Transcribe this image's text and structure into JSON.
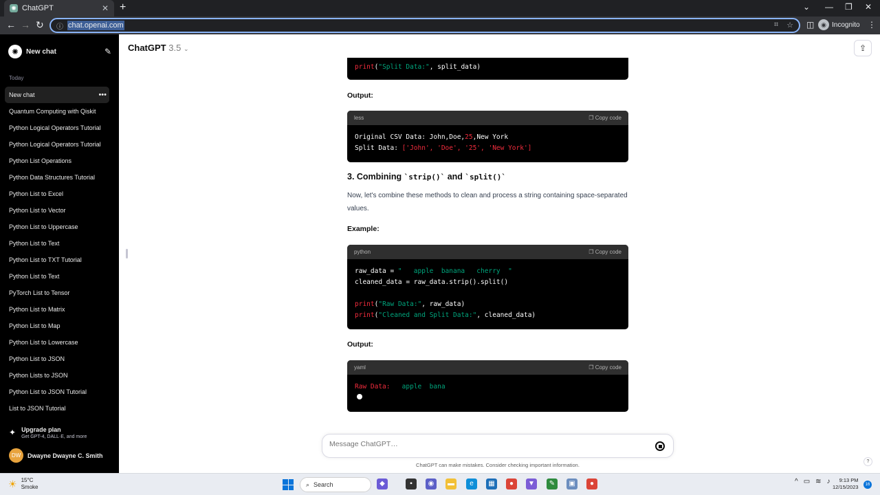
{
  "browser": {
    "tab_title": "ChatGPT",
    "url": "chat.openai.com",
    "incognito_label": "Incognito"
  },
  "sidebar": {
    "new_chat": "New chat",
    "section_today": "Today",
    "items": [
      {
        "label": "New chat",
        "active": true
      },
      {
        "label": "Quantum Computing with Qiskit"
      },
      {
        "label": "Python Logical Operators Tutorial"
      },
      {
        "label": "Python Logical Operators Tutorial"
      },
      {
        "label": "Python List Operations"
      },
      {
        "label": "Python Data Structures Tutorial"
      },
      {
        "label": "Python List to Excel"
      },
      {
        "label": "Python List to Vector"
      },
      {
        "label": "Python List to Uppercase"
      },
      {
        "label": "Python List to Text"
      },
      {
        "label": "Python List to TXT Tutorial"
      },
      {
        "label": "Python List to Text"
      },
      {
        "label": "PyTorch List to Tensor"
      },
      {
        "label": "Python List to Matrix"
      },
      {
        "label": "Python List to Map"
      },
      {
        "label": "Python List to Lowercase"
      },
      {
        "label": "Python List to JSON"
      },
      {
        "label": "Python Lists to JSON"
      },
      {
        "label": "Python List to JSON Tutorial"
      },
      {
        "label": "List to JSON Tutorial"
      }
    ],
    "upgrade_title": "Upgrade plan",
    "upgrade_sub": "Get GPT-4, DALL·E, and more",
    "user_initials": "DW",
    "user_name": "Dwayne Dwayne C. Smith"
  },
  "header": {
    "title": "ChatGPT",
    "version": "3.5"
  },
  "content": {
    "code0_line": "print(\"Split Data:\", split_data)",
    "output_label_1": "Output:",
    "code1": {
      "lang": "less",
      "copy": "Copy code",
      "l1a": "Original CSV Data: John,Doe,",
      "l1b": "25",
      "l1c": ",New York",
      "l2a": "Split Data: ",
      "l2b": "['John', 'Doe', '25', 'New York']"
    },
    "heading_num": "3. Combining ",
    "heading_code1": "`strip()`",
    "heading_and": " and ",
    "heading_code2": "`split()`",
    "paragraph": "Now, let's combine these methods to clean and process a string containing space-separated values.",
    "example_label": "Example:",
    "code2": {
      "lang": "python",
      "copy": "Copy code",
      "l1a": "raw_data = ",
      "l1b": "\"   apple  banana   cherry  \"",
      "l2": "cleaned_data = raw_data.strip().split()",
      "l3a": "print",
      "l3b": "(",
      "l3c": "\"Raw Data:\"",
      "l3d": ", raw_data)",
      "l4a": "print",
      "l4b": "(",
      "l4c": "\"Cleaned and Split Data:\"",
      "l4d": ", cleaned_data)"
    },
    "output_label_2": "Output:",
    "code3": {
      "lang": "yaml",
      "copy": "Copy code",
      "l1a": "Raw Data:",
      "l1b": "   apple  bana"
    }
  },
  "composer": {
    "placeholder": "Message ChatGPT…",
    "disclaimer": "ChatGPT can make mistakes. Consider checking important information."
  },
  "taskbar": {
    "temp": "15°C",
    "weather": "Smoke",
    "search": "Search",
    "time": "9:13 PM",
    "date": "12/15/2023",
    "notif_count": "16"
  }
}
